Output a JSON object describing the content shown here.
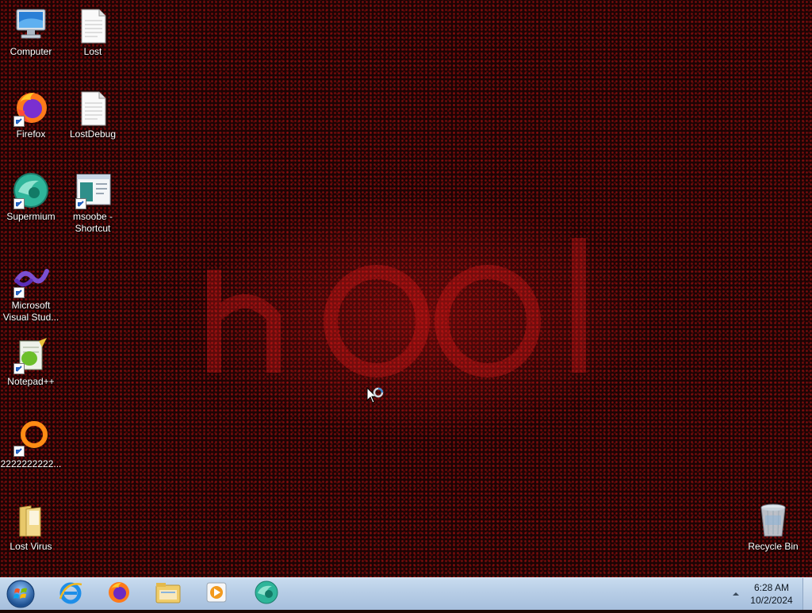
{
  "desktop": {
    "icons_left": [
      {
        "label": "Computer",
        "icon": "computer-icon"
      },
      {
        "label": "Firefox",
        "icon": "firefox-icon"
      },
      {
        "label": "Supermium",
        "icon": "supermium-icon"
      },
      {
        "label": "Microsoft Visual Stud...",
        "icon": "visual-studio-icon"
      },
      {
        "label": "Notepad++",
        "icon": "notepadpp-icon"
      },
      {
        "label": "2222222222...",
        "icon": "orange-ring-icon"
      },
      {
        "label": "Lost Virus",
        "icon": "folder-icon"
      }
    ],
    "icons_second": [
      {
        "label": "Lost",
        "icon": "text-document-icon"
      },
      {
        "label": "LostDebug",
        "icon": "text-document-icon"
      },
      {
        "label": "msoobe - Shortcut",
        "icon": "msoobe-app-icon"
      }
    ],
    "recycle_bin": {
      "label": "Recycle Bin",
      "icon": "recycle-bin-icon"
    }
  },
  "taskbar": {
    "start": "start-orb-icon",
    "pinned": [
      "internet-explorer-icon",
      "firefox-icon",
      "file-explorer-icon",
      "media-player-icon",
      "supermium-icon"
    ],
    "clock": {
      "time": "6:28 AM",
      "date": "10/2/2024"
    }
  }
}
